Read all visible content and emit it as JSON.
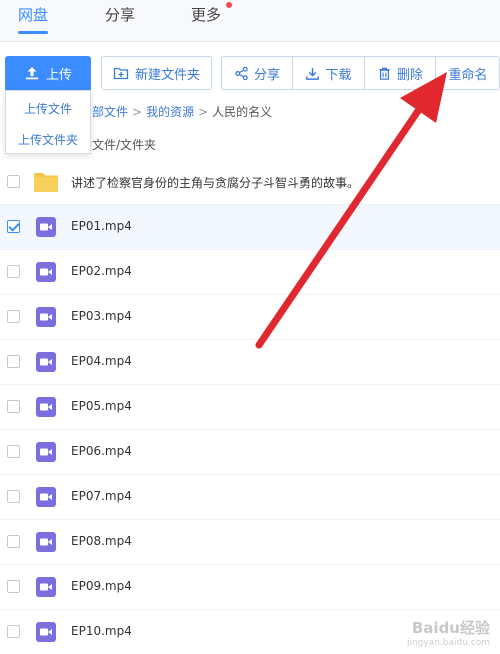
{
  "nav": {
    "tabs": [
      "网盘",
      "分享",
      "更多"
    ],
    "active_tab": "网盘",
    "accent": "#3b8cff"
  },
  "toolbar": {
    "upload_label": "上传",
    "new_folder_label": "新建文件夹",
    "share_label": "分享",
    "download_label": "下载",
    "delete_label": "删除",
    "rename_label": "重命名"
  },
  "upload_menu": {
    "items": [
      "上传文件",
      "上传文件夹"
    ]
  },
  "breadcrumb": {
    "items": [
      "部文件",
      "我的资源",
      "人民的名义"
    ]
  },
  "list_header": "文件/文件夹",
  "files": [
    {
      "name": "讲述了检察官身份的主角与贪腐分子斗智斗勇的故事。",
      "type": "folder",
      "checked": false
    },
    {
      "name": "EP01.mp4",
      "type": "video",
      "checked": true
    },
    {
      "name": "EP02.mp4",
      "type": "video",
      "checked": false
    },
    {
      "name": "EP03.mp4",
      "type": "video",
      "checked": false
    },
    {
      "name": "EP04.mp4",
      "type": "video",
      "checked": false
    },
    {
      "name": "EP05.mp4",
      "type": "video",
      "checked": false
    },
    {
      "name": "EP06.mp4",
      "type": "video",
      "checked": false
    },
    {
      "name": "EP07.mp4",
      "type": "video",
      "checked": false
    },
    {
      "name": "EP08.mp4",
      "type": "video",
      "checked": false
    },
    {
      "name": "EP09.mp4",
      "type": "video",
      "checked": false
    },
    {
      "name": "EP10.mp4",
      "type": "video",
      "checked": false
    }
  ],
  "colors": {
    "folder": "#f7c548",
    "video": "#7b6fe0",
    "annotation_arrow": "#e0282e"
  },
  "watermark": {
    "line1": "Baidu经验",
    "line2": "jingyan.baidu.com"
  }
}
